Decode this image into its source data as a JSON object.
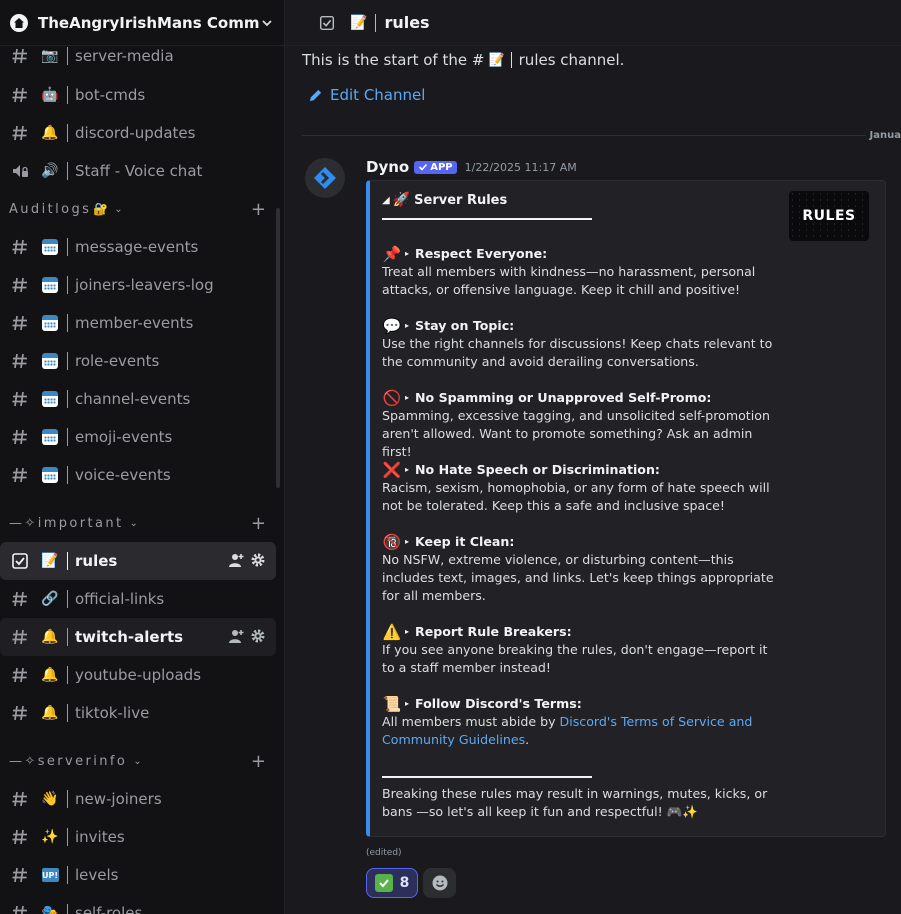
{
  "server": {
    "name": "TheAngryIrishMans Commu..."
  },
  "sidebar": {
    "top_channels": [
      {
        "label": "server-media",
        "emoji": "📷"
      },
      {
        "label": "bot-cmds",
        "emoji": "🤖"
      },
      {
        "label": "discord-updates",
        "emoji": "🔔"
      },
      {
        "label": "Staff - Voice chat",
        "emoji": "🔊"
      }
    ],
    "cat_auditlogs": {
      "label": "Auditlogs",
      "emoji": "🔐"
    },
    "audit_channels": [
      {
        "label": "message-events"
      },
      {
        "label": "joiners-leavers-log"
      },
      {
        "label": "member-events"
      },
      {
        "label": "role-events"
      },
      {
        "label": "channel-events"
      },
      {
        "label": "emoji-events"
      },
      {
        "label": "voice-events"
      }
    ],
    "cat_important": {
      "label": "—✧important"
    },
    "important_channels": [
      {
        "label": "rules",
        "emoji": "📝"
      },
      {
        "label": "official-links",
        "emoji": "🔗"
      },
      {
        "label": "twitch-alerts",
        "emoji": "🔔"
      },
      {
        "label": "youtube-uploads",
        "emoji": "🔔"
      },
      {
        "label": "tiktok-live",
        "emoji": "🔔"
      }
    ],
    "cat_serverinfo": {
      "label": "—✧serverinfo"
    },
    "serverinfo_channels": [
      {
        "label": "new-joiners",
        "emoji": "👋"
      },
      {
        "label": "invites",
        "emoji": "✨"
      },
      {
        "label": "levels",
        "emoji": "UP!"
      },
      {
        "label": "self-roles",
        "emoji": "🎭"
      }
    ]
  },
  "header": {
    "channel_emoji": "📝",
    "channel_name": "rules"
  },
  "channel_start": {
    "prefix": "This is the start of the #",
    "emoji": "📝",
    "suffix": "rules channel.",
    "edit_label": "Edit Channel"
  },
  "date_divider": "Janua",
  "message": {
    "author": "Dyno",
    "badge": "APP",
    "timestamp": "1/22/2025 11:17 AM",
    "edited": "(edited)",
    "embed": {
      "thumbnail_text": "RULES",
      "title": "Server Rules",
      "rules": [
        {
          "emoji": "📌",
          "title": "Respect Everyone:",
          "text": "Treat all members with kindness—no harassment, personal attacks, or offensive language. Keep it chill and positive!"
        },
        {
          "emoji": "💬",
          "title": "Stay on Topic:",
          "text": "Use the right channels for discussions! Keep chats relevant to the community and avoid derailing conversations."
        },
        {
          "emoji": "🚫",
          "title": "No Spamming or Unapproved Self-Promo:",
          "text": "Spamming, excessive tagging, and unsolicited self-promotion aren't allowed. Want to promote something? Ask an admin first!"
        },
        {
          "emoji": "❌",
          "title": "No Hate Speech or Discrimination:",
          "text": "Racism, sexism, homophobia, or any form of hate speech will not be tolerated. Keep this a safe and inclusive space!"
        },
        {
          "emoji": "🔞",
          "title": "Keep it Clean:",
          "text": "No NSFW, extreme violence, or disturbing content—this includes text, images, and links. Let's keep things appropriate for all members."
        },
        {
          "emoji": "⚠️",
          "title": "Report Rule Breakers:",
          "text": "If you see anyone breaking the rules, don't engage—report it to a staff member instead!"
        }
      ],
      "last_rule": {
        "emoji": "📜",
        "title": "Follow Discord's Terms:",
        "text_prefix": "All members must abide by ",
        "link": "Discord's Terms of Service and Community Guidelines",
        "text_suffix": "."
      },
      "footer": "Breaking these rules may result in warnings, mutes, kicks, or bans —so let's all keep it fun and respectful! 🎮✨"
    },
    "reaction": {
      "emoji": "✅",
      "count": "8"
    }
  },
  "colors": {
    "accent": "#5865f2",
    "embed_bar": "#3b8cf0",
    "link": "#5aa9f5"
  }
}
